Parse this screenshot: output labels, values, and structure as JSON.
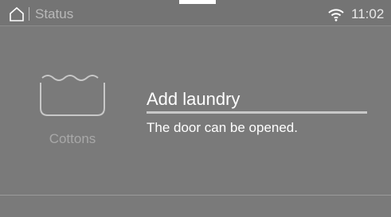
{
  "status_bar": {
    "title": "Status",
    "home_icon": "home-icon",
    "wifi_icon": "wifi-icon",
    "time": "11:02"
  },
  "program": {
    "icon": "wash-tub-icon",
    "label": "Cottons"
  },
  "message": {
    "headline": "Add laundry",
    "detail": "The door can be opened."
  }
}
